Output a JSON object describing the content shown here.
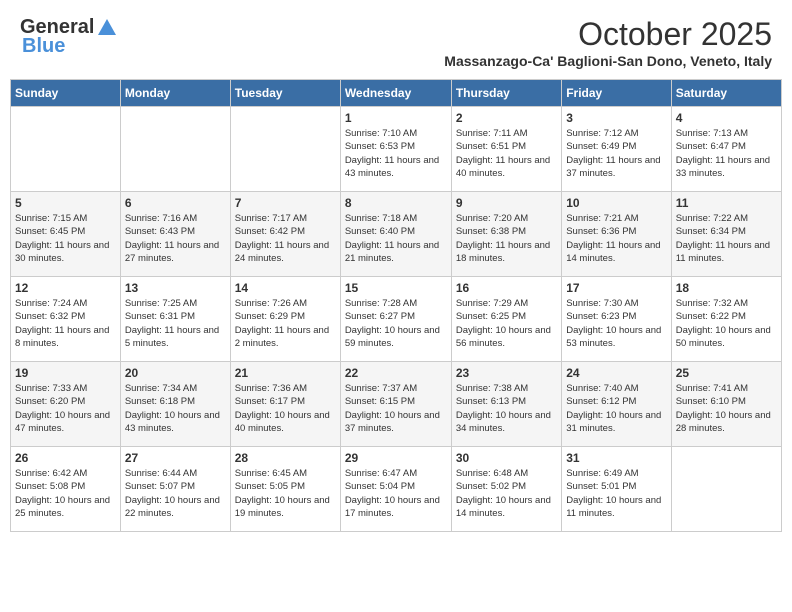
{
  "logo": {
    "general": "General",
    "blue": "Blue"
  },
  "title": "October 2025",
  "location": "Massanzago-Ca' Baglioni-San Dono, Veneto, Italy",
  "days_of_week": [
    "Sunday",
    "Monday",
    "Tuesday",
    "Wednesday",
    "Thursday",
    "Friday",
    "Saturday"
  ],
  "weeks": [
    [
      {
        "day": "",
        "info": ""
      },
      {
        "day": "",
        "info": ""
      },
      {
        "day": "",
        "info": ""
      },
      {
        "day": "1",
        "info": "Sunrise: 7:10 AM\nSunset: 6:53 PM\nDaylight: 11 hours and 43 minutes."
      },
      {
        "day": "2",
        "info": "Sunrise: 7:11 AM\nSunset: 6:51 PM\nDaylight: 11 hours and 40 minutes."
      },
      {
        "day": "3",
        "info": "Sunrise: 7:12 AM\nSunset: 6:49 PM\nDaylight: 11 hours and 37 minutes."
      },
      {
        "day": "4",
        "info": "Sunrise: 7:13 AM\nSunset: 6:47 PM\nDaylight: 11 hours and 33 minutes."
      }
    ],
    [
      {
        "day": "5",
        "info": "Sunrise: 7:15 AM\nSunset: 6:45 PM\nDaylight: 11 hours and 30 minutes."
      },
      {
        "day": "6",
        "info": "Sunrise: 7:16 AM\nSunset: 6:43 PM\nDaylight: 11 hours and 27 minutes."
      },
      {
        "day": "7",
        "info": "Sunrise: 7:17 AM\nSunset: 6:42 PM\nDaylight: 11 hours and 24 minutes."
      },
      {
        "day": "8",
        "info": "Sunrise: 7:18 AM\nSunset: 6:40 PM\nDaylight: 11 hours and 21 minutes."
      },
      {
        "day": "9",
        "info": "Sunrise: 7:20 AM\nSunset: 6:38 PM\nDaylight: 11 hours and 18 minutes."
      },
      {
        "day": "10",
        "info": "Sunrise: 7:21 AM\nSunset: 6:36 PM\nDaylight: 11 hours and 14 minutes."
      },
      {
        "day": "11",
        "info": "Sunrise: 7:22 AM\nSunset: 6:34 PM\nDaylight: 11 hours and 11 minutes."
      }
    ],
    [
      {
        "day": "12",
        "info": "Sunrise: 7:24 AM\nSunset: 6:32 PM\nDaylight: 11 hours and 8 minutes."
      },
      {
        "day": "13",
        "info": "Sunrise: 7:25 AM\nSunset: 6:31 PM\nDaylight: 11 hours and 5 minutes."
      },
      {
        "day": "14",
        "info": "Sunrise: 7:26 AM\nSunset: 6:29 PM\nDaylight: 11 hours and 2 minutes."
      },
      {
        "day": "15",
        "info": "Sunrise: 7:28 AM\nSunset: 6:27 PM\nDaylight: 10 hours and 59 minutes."
      },
      {
        "day": "16",
        "info": "Sunrise: 7:29 AM\nSunset: 6:25 PM\nDaylight: 10 hours and 56 minutes."
      },
      {
        "day": "17",
        "info": "Sunrise: 7:30 AM\nSunset: 6:23 PM\nDaylight: 10 hours and 53 minutes."
      },
      {
        "day": "18",
        "info": "Sunrise: 7:32 AM\nSunset: 6:22 PM\nDaylight: 10 hours and 50 minutes."
      }
    ],
    [
      {
        "day": "19",
        "info": "Sunrise: 7:33 AM\nSunset: 6:20 PM\nDaylight: 10 hours and 47 minutes."
      },
      {
        "day": "20",
        "info": "Sunrise: 7:34 AM\nSunset: 6:18 PM\nDaylight: 10 hours and 43 minutes."
      },
      {
        "day": "21",
        "info": "Sunrise: 7:36 AM\nSunset: 6:17 PM\nDaylight: 10 hours and 40 minutes."
      },
      {
        "day": "22",
        "info": "Sunrise: 7:37 AM\nSunset: 6:15 PM\nDaylight: 10 hours and 37 minutes."
      },
      {
        "day": "23",
        "info": "Sunrise: 7:38 AM\nSunset: 6:13 PM\nDaylight: 10 hours and 34 minutes."
      },
      {
        "day": "24",
        "info": "Sunrise: 7:40 AM\nSunset: 6:12 PM\nDaylight: 10 hours and 31 minutes."
      },
      {
        "day": "25",
        "info": "Sunrise: 7:41 AM\nSunset: 6:10 PM\nDaylight: 10 hours and 28 minutes."
      }
    ],
    [
      {
        "day": "26",
        "info": "Sunrise: 6:42 AM\nSunset: 5:08 PM\nDaylight: 10 hours and 25 minutes."
      },
      {
        "day": "27",
        "info": "Sunrise: 6:44 AM\nSunset: 5:07 PM\nDaylight: 10 hours and 22 minutes."
      },
      {
        "day": "28",
        "info": "Sunrise: 6:45 AM\nSunset: 5:05 PM\nDaylight: 10 hours and 19 minutes."
      },
      {
        "day": "29",
        "info": "Sunrise: 6:47 AM\nSunset: 5:04 PM\nDaylight: 10 hours and 17 minutes."
      },
      {
        "day": "30",
        "info": "Sunrise: 6:48 AM\nSunset: 5:02 PM\nDaylight: 10 hours and 14 minutes."
      },
      {
        "day": "31",
        "info": "Sunrise: 6:49 AM\nSunset: 5:01 PM\nDaylight: 10 hours and 11 minutes."
      },
      {
        "day": "",
        "info": ""
      }
    ]
  ]
}
